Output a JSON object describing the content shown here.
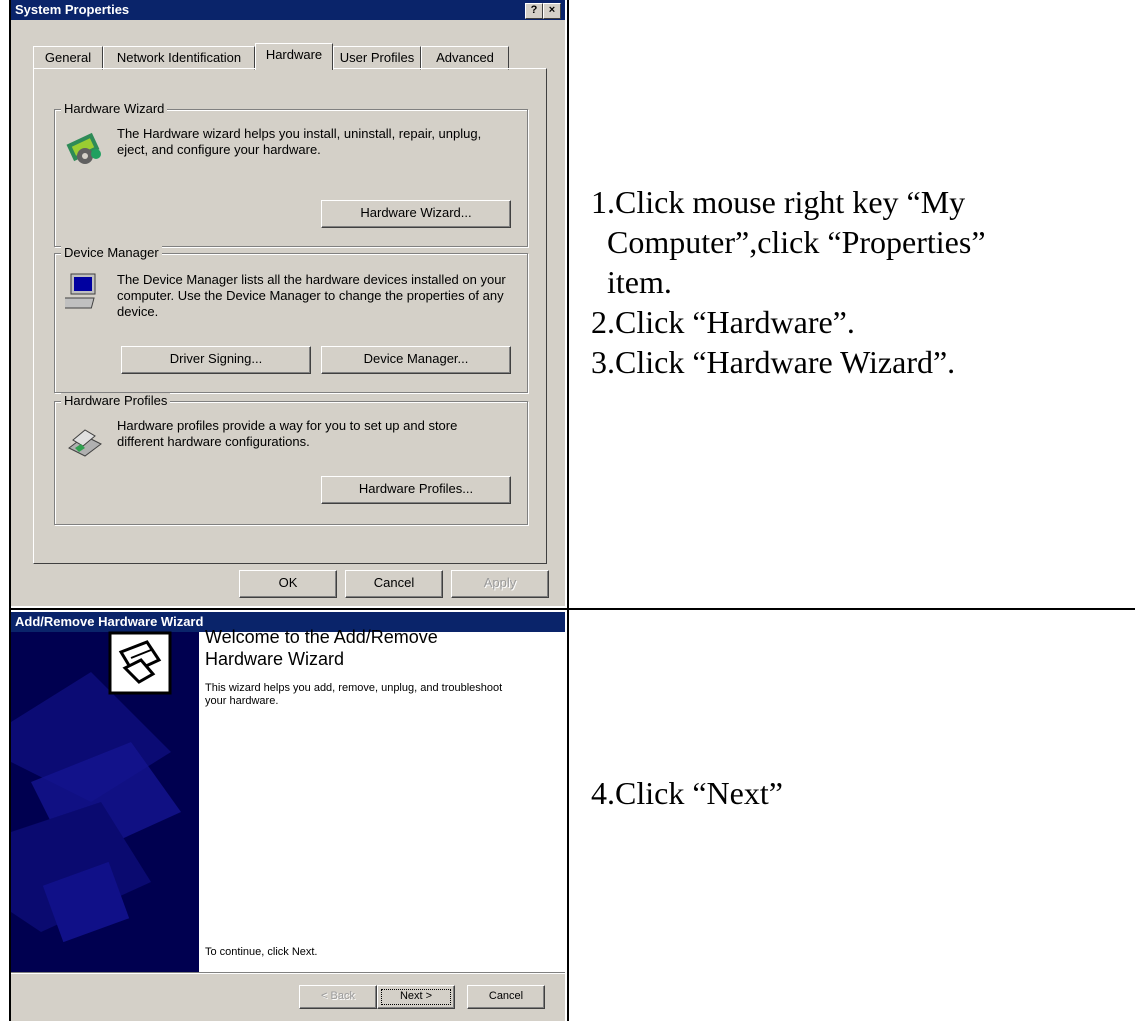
{
  "sysprops": {
    "title": "System Properties",
    "help_btn": "?",
    "close_btn": "×",
    "tabs": [
      "General",
      "Network Identification",
      "Hardware",
      "User Profiles",
      "Advanced"
    ],
    "hw_wizard": {
      "label": "Hardware Wizard",
      "text": "The Hardware wizard helps you install, uninstall, repair, unplug, eject, and configure your hardware.",
      "button": "Hardware Wizard..."
    },
    "device_manager": {
      "label": "Device Manager",
      "text": "The Device Manager lists all the hardware devices installed on your computer. Use the Device Manager to change the properties of any device.",
      "btn_signing": "Driver Signing...",
      "btn_devmgr": "Device Manager..."
    },
    "hw_profiles": {
      "label": "Hardware Profiles",
      "text": "Hardware profiles provide a way for you to set up and store different hardware configurations.",
      "button": "Hardware Profiles..."
    },
    "ok": "OK",
    "cancel": "Cancel",
    "apply": "Apply"
  },
  "wizard": {
    "title": "Add/Remove Hardware Wizard",
    "heading": "Welcome to the Add/Remove Hardware Wizard",
    "text": "This wizard helps you add, remove, unplug, and troubleshoot your hardware.",
    "continue": "To continue, click Next.",
    "back": "< Back",
    "next": "Next >",
    "cancel": "Cancel"
  },
  "steps_top": [
    "1.Click mouse right key “My",
    "  Computer”,click “Properties”",
    "  item.",
    "2.Click “Hardware”.",
    "3.Click “Hardware Wizard”."
  ],
  "steps_bottom": [
    "4.Click “Next”"
  ]
}
